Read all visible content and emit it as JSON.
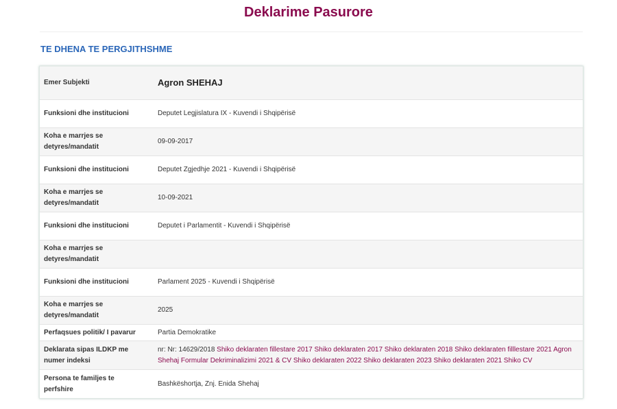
{
  "page": {
    "title": "Deklarime Pasurore",
    "section_title": "TE DHENA TE PERGJITHSHME"
  },
  "subject": {
    "label": "Emer Subjekti",
    "value": "Agron SHEHAJ"
  },
  "rows": [
    {
      "label": "Funksioni dhe institucioni",
      "value": "Deputet Legjislatura IX - Kuvendi i Shqipërisë"
    },
    {
      "label": "Koha e marrjes se detyres/mandatit",
      "value": "09-09-2017"
    },
    {
      "label": "Funksioni dhe institucioni",
      "value": "Deputet Zgjedhje 2021 - Kuvendi i Shqipërisë"
    },
    {
      "label": "Koha e marrjes se detyres/mandatit",
      "value": "10-09-2021"
    },
    {
      "label": "Funksioni dhe institucioni",
      "value": "Deputet i Parlamentit - Kuvendi i Shqipërisë"
    },
    {
      "label": "Koha e marrjes se detyres/mandatit",
      "value": ""
    },
    {
      "label": "Funksioni dhe institucioni",
      "value": "Parlament 2025 - Kuvendi i Shqipërisë"
    },
    {
      "label": "Koha e marrjes se detyres/mandatit",
      "value": "2025"
    }
  ],
  "party": {
    "label": "Perfaqsues politik/ I pavarur",
    "value": "Partia Demokratike"
  },
  "declaration": {
    "label": "Deklarata sipas ILDKP me numer indeksi",
    "prefix": "nr: Nr: 14629/2018",
    "links": [
      "Shiko deklaraten fillestare 2017",
      "Shiko deklaraten 2017",
      "Shiko deklaraten 2018",
      "Shiko deklaraten filllestare 2021",
      "Agron Shehaj Formular Dekriminalizimi 2021 & CV",
      "Shiko deklaraten 2022",
      "Shiko deklaraten 2023",
      "Shiko deklaraten 2021",
      "Shiko CV"
    ]
  },
  "family": {
    "label": "Persona te familjes te perfshire",
    "value": "Bashkëshortja, Znj. Enida Shehaj"
  },
  "colors": {
    "title": "#8a0b4e",
    "section": "#2a66b8",
    "link": "#8a0b4e"
  }
}
